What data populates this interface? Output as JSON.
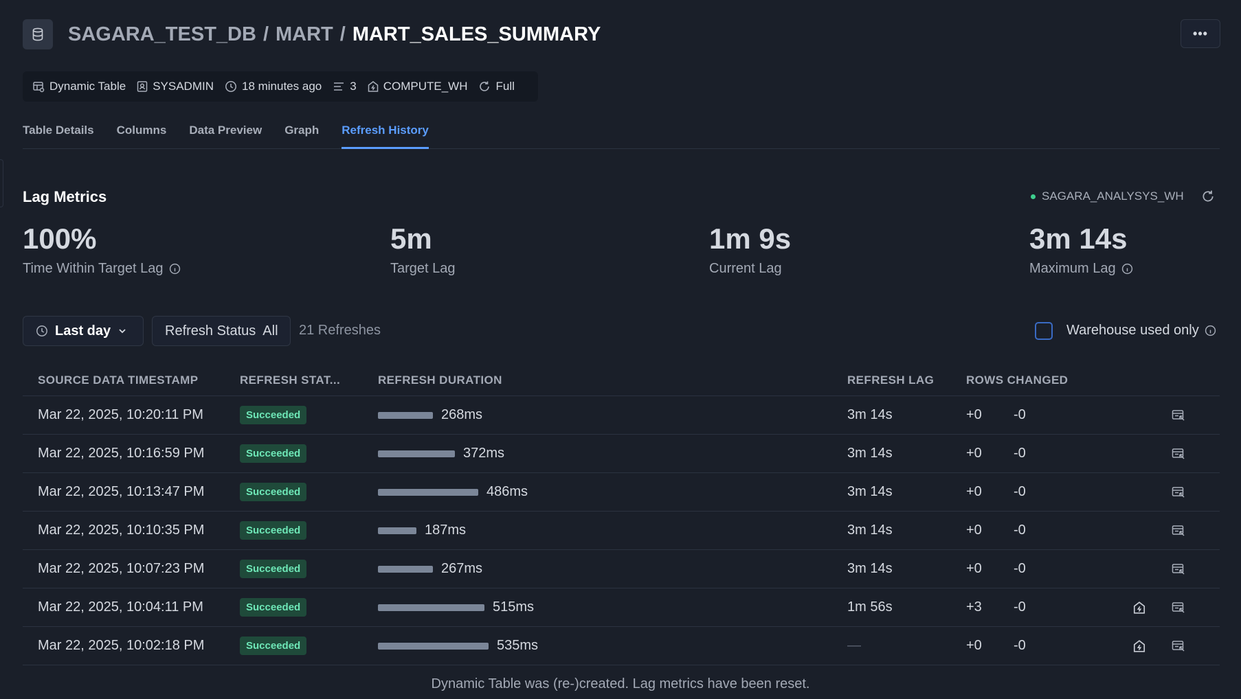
{
  "header": {
    "crumbs": [
      "SAGARA_TEST_DB",
      "MART"
    ],
    "separator": "/",
    "current": "MART_SALES_SUMMARY",
    "more_label": "•••"
  },
  "meta": {
    "type": "Dynamic Table",
    "owner": "SYSADMIN",
    "updated": "18 minutes ago",
    "columns": "3",
    "warehouse": "COMPUTE_WH",
    "refresh_mode": "Full"
  },
  "tabs": [
    "Table Details",
    "Columns",
    "Data Preview",
    "Graph",
    "Refresh History"
  ],
  "active_tab": "Refresh History",
  "lag_metrics": {
    "title": "Lag Metrics",
    "warehouse": "SAGARA_ANALYSYS_WH",
    "items": [
      {
        "value": "100%",
        "label": "Time Within Target Lag"
      },
      {
        "value": "5m",
        "label": "Target Lag"
      },
      {
        "value": "1m 9s",
        "label": "Current Lag"
      },
      {
        "value": "3m 14s",
        "label": "Maximum Lag"
      }
    ]
  },
  "filters": {
    "range": "Last day",
    "status_label": "Refresh Status",
    "status_value": "All",
    "count": "21 Refreshes",
    "warehouse_only": "Warehouse used only"
  },
  "table": {
    "headers": {
      "timestamp": "SOURCE DATA TIMESTAMP",
      "status": "REFRESH STAT...",
      "duration": "REFRESH DURATION",
      "lag": "REFRESH LAG",
      "rows": "ROWS CHANGED"
    },
    "rows": [
      {
        "timestamp": "Mar 22, 2025, 10:20:11 PM",
        "status": "Succeeded",
        "duration": "268ms",
        "duration_ms": 268,
        "lag": "3m 14s",
        "added": "+0",
        "removed": "-0",
        "warehouse_icon": false
      },
      {
        "timestamp": "Mar 22, 2025, 10:16:59 PM",
        "status": "Succeeded",
        "duration": "372ms",
        "duration_ms": 372,
        "lag": "3m 14s",
        "added": "+0",
        "removed": "-0",
        "warehouse_icon": false
      },
      {
        "timestamp": "Mar 22, 2025, 10:13:47 PM",
        "status": "Succeeded",
        "duration": "486ms",
        "duration_ms": 486,
        "lag": "3m 14s",
        "added": "+0",
        "removed": "-0",
        "warehouse_icon": false
      },
      {
        "timestamp": "Mar 22, 2025, 10:10:35 PM",
        "status": "Succeeded",
        "duration": "187ms",
        "duration_ms": 187,
        "lag": "3m 14s",
        "added": "+0",
        "removed": "-0",
        "warehouse_icon": false
      },
      {
        "timestamp": "Mar 22, 2025, 10:07:23 PM",
        "status": "Succeeded",
        "duration": "267ms",
        "duration_ms": 267,
        "lag": "3m 14s",
        "added": "+0",
        "removed": "-0",
        "warehouse_icon": false
      },
      {
        "timestamp": "Mar 22, 2025, 10:04:11 PM",
        "status": "Succeeded",
        "duration": "515ms",
        "duration_ms": 515,
        "lag": "1m 56s",
        "added": "+3",
        "removed": "-0",
        "warehouse_icon": true
      },
      {
        "timestamp": "Mar 22, 2025, 10:02:18 PM",
        "status": "Succeeded",
        "duration": "535ms",
        "duration_ms": 535,
        "lag": "—",
        "added": "+0",
        "removed": "-0",
        "warehouse_icon": true
      }
    ]
  },
  "footer_note": "Dynamic Table was (re-)created. Lag metrics have been reset.",
  "colors": {
    "background": "#1a1f29",
    "accent": "#5b9dff",
    "success_bg": "#1f4a3a",
    "success_text": "#6ee7b7",
    "bar": "#7b8698"
  },
  "icons": {
    "header": "database-icon",
    "meta": [
      "dynamic-table-icon",
      "user-icon",
      "clock-icon",
      "list-icon",
      "warehouse-icon",
      "refresh-icon"
    ],
    "row_actions": [
      "warehouse-icon",
      "query-details-icon"
    ]
  }
}
